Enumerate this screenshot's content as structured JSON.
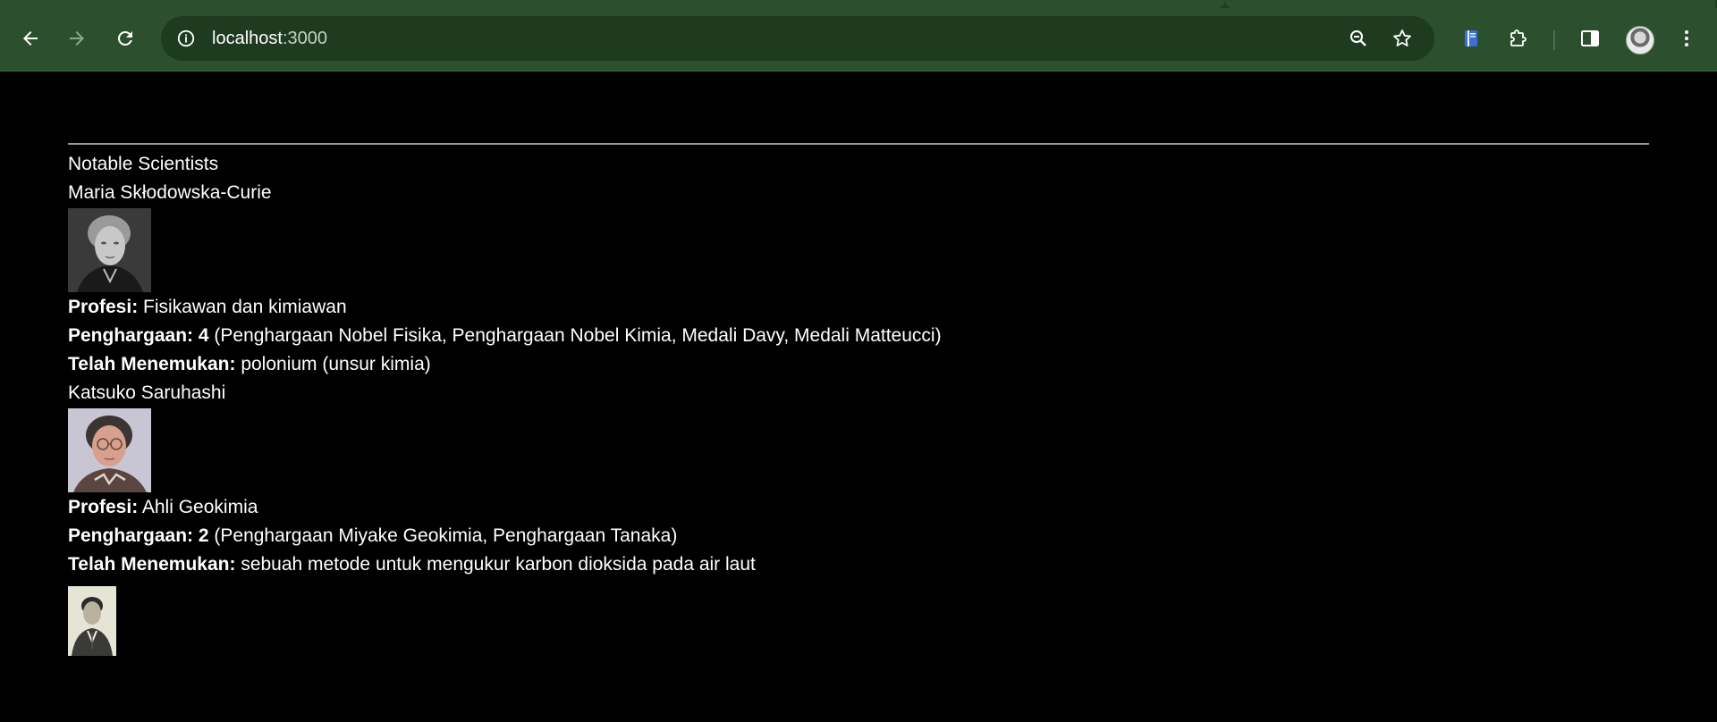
{
  "browser": {
    "url_host": "localhost",
    "url_port": ":3000",
    "icons": {
      "back": "arrow-left-icon",
      "forward": "arrow-right-icon",
      "reload": "reload-icon",
      "site_info": "info-icon",
      "zoom": "zoom-out-icon",
      "bookmark": "star-icon",
      "reading_list": "book-icon",
      "extensions": "puzzle-icon",
      "side_panel": "side-panel-icon",
      "menu": "kebab-menu-icon"
    },
    "colors": {
      "frame": "#2c4f2d",
      "omnibox": "#1e3a1f"
    }
  },
  "page": {
    "heading": "Notable Scientists",
    "scientists": [
      {
        "name": "Maria Skłodowska-Curie",
        "profession_label": "Profesi:",
        "profession": "Fisikawan dan kimiawan",
        "awards_label": "Penghargaan: 4",
        "awards": "(Penghargaan Nobel Fisika, Penghargaan Nobel Kimia, Medali Davy, Medali Matteucci)",
        "discovery_label": "Telah Menemukan:",
        "discovery": "polonium (unsur kimia)"
      },
      {
        "name": "Katsuko Saruhashi",
        "profession_label": "Profesi:",
        "profession": "Ahli Geokimia",
        "awards_label": "Penghargaan: 2",
        "awards": "(Penghargaan Miyake Geokimia, Penghargaan Tanaka)",
        "discovery_label": "Telah Menemukan:",
        "discovery": "sebuah metode untuk mengukur karbon dioksida pada air laut"
      }
    ]
  }
}
